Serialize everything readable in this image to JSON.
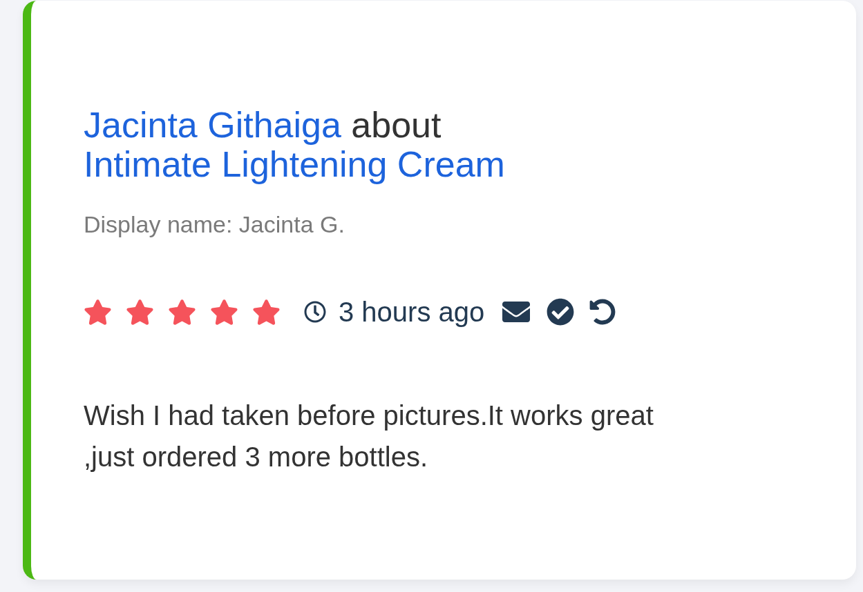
{
  "review": {
    "reviewer": "Jacinta Githaiga",
    "connector": "about",
    "product": "Intimate Lightening Cream",
    "display_name": "Display name: Jacinta G.",
    "stars": 5,
    "time": "3 hours ago",
    "body": "Wish I had taken before pictures.It works great ,just ordered 3 more bottles."
  }
}
